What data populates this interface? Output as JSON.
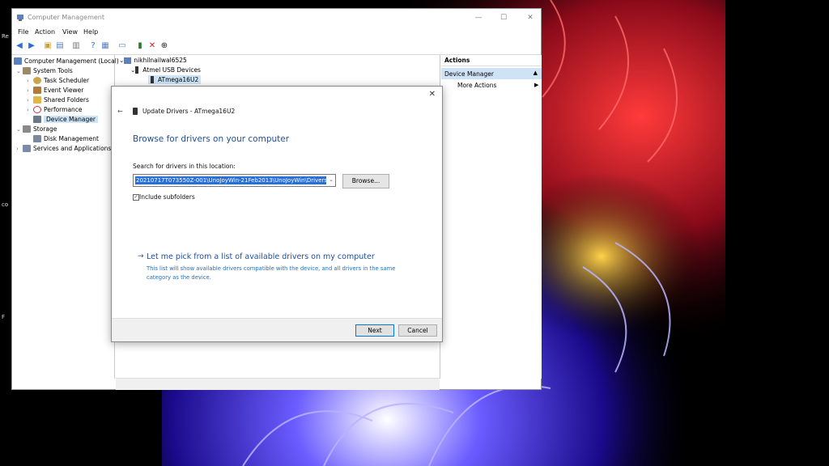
{
  "window": {
    "title": "Computer Management",
    "minimize": "—",
    "maximize": "☐",
    "close": "✕"
  },
  "menu": [
    "File",
    "Action",
    "View",
    "Help"
  ],
  "tree": {
    "root": "Computer Management (Local)",
    "system_tools": "System Tools",
    "task_scheduler": "Task Scheduler",
    "event_viewer": "Event Viewer",
    "shared_folders": "Shared Folders",
    "performance": "Performance",
    "device_manager": "Device Manager",
    "storage": "Storage",
    "disk_management": "Disk Management",
    "services": "Services and Applications"
  },
  "devices": {
    "computer": "nikhilnailwal6525",
    "category": "Atmel USB Devices",
    "device": "ATmega16U2"
  },
  "actions": {
    "header": "Actions",
    "device_manager": "Device Manager",
    "more_actions": "More Actions"
  },
  "dialog": {
    "title": "Update Drivers - ATmega16U2",
    "heading": "Browse for drivers on your computer",
    "search_label": "Search for drivers in this location:",
    "path": "20210717T073550Z-001\\UnoJoyWin-21Feb2013\\UnoJoyWin\\Drivers",
    "browse": "Browse...",
    "include_subfolders": "Include subfolders",
    "pick_link": "Let me pick from a list of available drivers on my computer",
    "pick_desc": "This list will show available drivers compatible with the device, and all drivers in the same category as the device.",
    "next": "Next",
    "cancel": "Cancel"
  },
  "desktop": {
    "label_re": "Re",
    "label_co": "co",
    "label_f": "F"
  },
  "colors": {
    "accent": "#0078d7",
    "heading_blue": "#1f4e9c",
    "selection": "#cde4f7"
  }
}
